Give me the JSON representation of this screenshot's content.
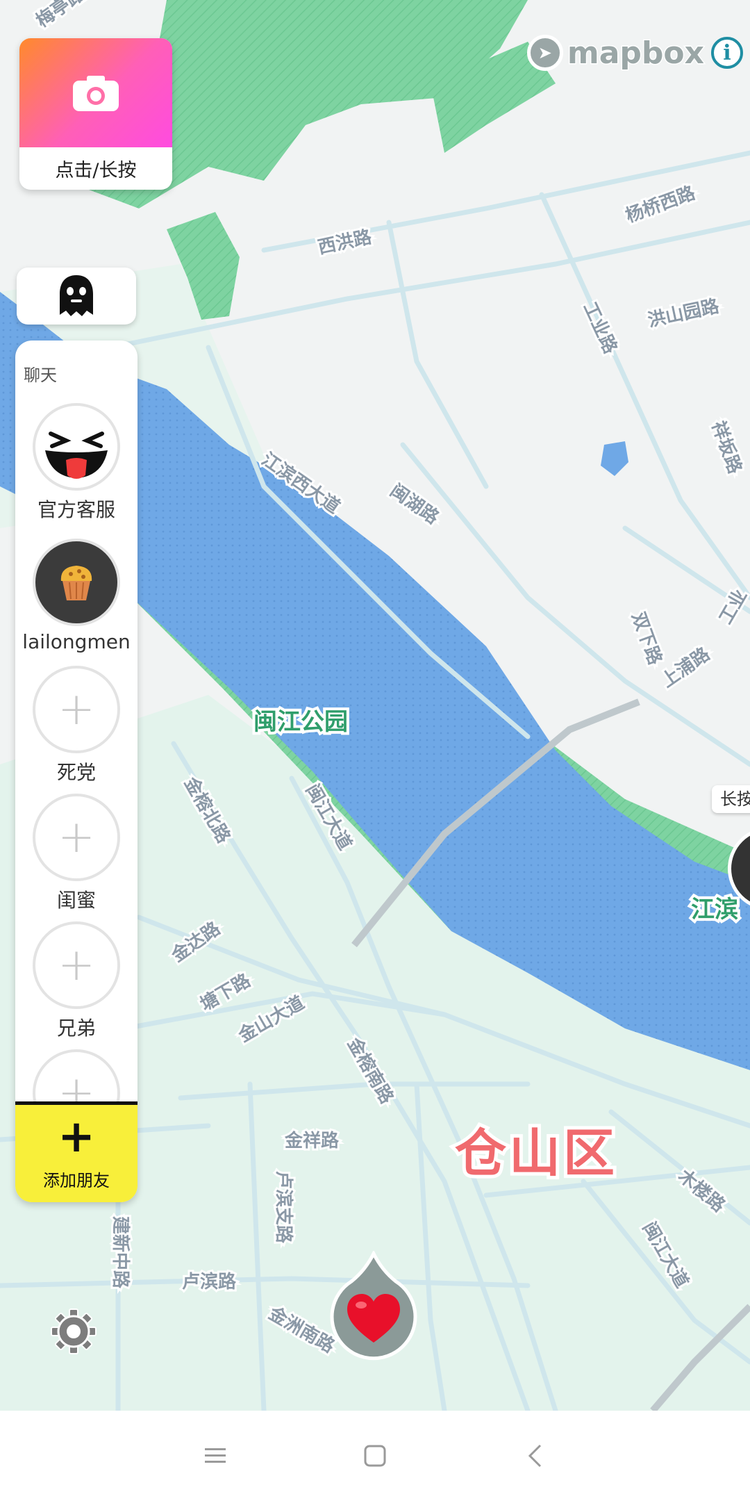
{
  "map": {
    "attribution": {
      "logo_text": "mapbox",
      "info_label": "i"
    },
    "labels": {
      "roads": [
        "梅亭路",
        "杨桥西路",
        "西洪路",
        "洪山园路",
        "工业路",
        "江滨西大道",
        "闽湖路",
        "双下路",
        "上浦路",
        "金榕北路",
        "闽江大道",
        "金达路",
        "塘下路",
        "金山大道",
        "金榕南路",
        "金祥路",
        "卢滨支路",
        "卢滨路",
        "建新中路",
        "金洲南路",
        "木楼路",
        "闽江大道",
        "祥坂路",
        "工业",
        "江滨"
      ],
      "park": "闽江公园",
      "district": "仓山区"
    }
  },
  "camera": {
    "label": "点击/长按",
    "icon": "camera-icon"
  },
  "ghost": {
    "icon": "ghost-icon"
  },
  "chat": {
    "title": "聊天",
    "friends": [
      {
        "name": "官方客服",
        "avatar": "laughing-face-avatar"
      },
      {
        "name": "lailongmen",
        "avatar": "muffin-avatar"
      },
      {
        "name": "死党",
        "avatar": "empty-slot"
      },
      {
        "name": "闺蜜",
        "avatar": "empty-slot"
      },
      {
        "name": "兄弟",
        "avatar": "empty-slot"
      },
      {
        "name": "",
        "avatar": "empty-slot"
      }
    ],
    "add_friend": {
      "icon": "+",
      "label": "添加朋友"
    }
  },
  "side_tag": {
    "label": "长按"
  },
  "heart": {
    "icon": "heart-icon"
  },
  "settings": {
    "icon": "gear-icon"
  },
  "navbar": {
    "icons": [
      "menu-icon",
      "home-icon",
      "back-icon"
    ]
  },
  "colors": {
    "water": "#6fa8e6",
    "park": "#7ed3a1",
    "road": "#cfe6ec",
    "add_friend_bg": "#f8ef3a",
    "district_label": "#f06a6e"
  }
}
